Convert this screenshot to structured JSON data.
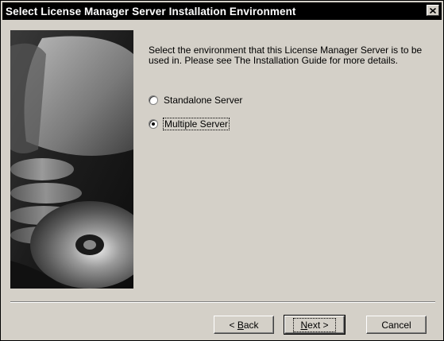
{
  "window": {
    "title": "Select License Manager Server Installation Environment"
  },
  "content": {
    "description": "Select the environment that this License Manager Server is to be used in. Please see The Installation Guide for more details.",
    "options": [
      {
        "label": "Standalone Server",
        "selected": false
      },
      {
        "label": "Multiple Server",
        "selected": true
      }
    ]
  },
  "buttons": {
    "back": {
      "mnemonic": "B",
      "rest": "ack",
      "prefix": "< "
    },
    "next": {
      "mnemonic": "N",
      "rest": "ext >"
    },
    "cancel": "Cancel"
  },
  "colors": {
    "dialog_face": "#d4d0c8",
    "titlebar": "#000000"
  }
}
